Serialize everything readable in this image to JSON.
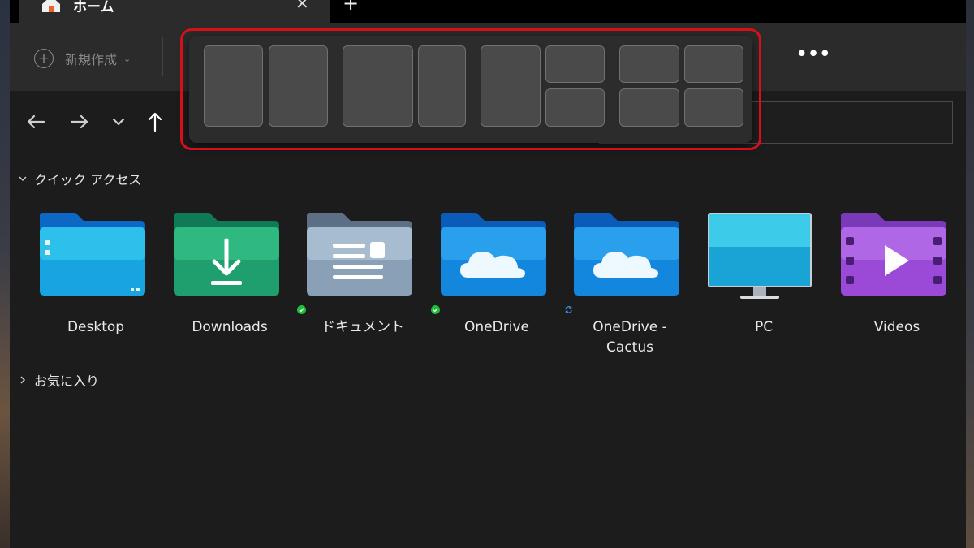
{
  "tab": {
    "title": "ホーム",
    "close_glyph": "✕",
    "new_tab_glyph": "+"
  },
  "toolbar": {
    "new_label": "新規作成",
    "more_glyph": "•••"
  },
  "snap_layouts": {
    "highlight_color": "#d4101a",
    "layouts": [
      "two-column-equal",
      "two-column-wide-left",
      "main-plus-two-stacked",
      "four-quadrant"
    ]
  },
  "quick_access": {
    "header": "クイック アクセス",
    "items": [
      {
        "label": "Desktop",
        "icon": "desktop-folder-icon"
      },
      {
        "label": "Downloads",
        "icon": "downloads-folder-icon"
      },
      {
        "label": "ドキュメント",
        "icon": "documents-folder-icon",
        "status": "synced"
      },
      {
        "label": "OneDrive",
        "icon": "onedrive-folder-icon",
        "status": "synced"
      },
      {
        "label": "OneDrive -\nCactus",
        "icon": "onedrive-folder-icon",
        "status": "syncing"
      },
      {
        "label": "PC",
        "icon": "monitor-icon"
      },
      {
        "label": "Videos",
        "icon": "videos-folder-icon"
      }
    ]
  },
  "favorites": {
    "header": "お気に入り"
  }
}
